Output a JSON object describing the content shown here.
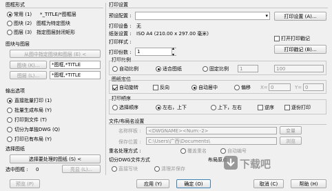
{
  "left": {
    "group_type": "图框形式",
    "radio_common": "常用 (1)",
    "common_value": "*_TITLE/*图框层",
    "radio_block": "图块 (2)",
    "block_desc": "图框为特定图块",
    "radio_layer": "图层 (3)",
    "layer_desc": "指定图层封闭矩形",
    "group_block_layer": "图块与图层",
    "pick_button": "从图中指定图块和图层 (E) <",
    "block_button": "图块 (K)...",
    "block_value": "*图框,*TITLE",
    "layer_button": "图层 (L)...",
    "layer_value": "*图框,*TITLE",
    "group_output": "输出选项",
    "opt1": "直接批量打印 (1)",
    "opt2": "批量生成布局 (Y)",
    "opt3": "打印到文件 (T)",
    "opt4": "切分为单独DWG (Q)",
    "opt5": "打印已有布局 (Y)",
    "group_select": "选择图纸",
    "select_button": "选择要处理的图纸 (S) <",
    "selected_label": "选中图框 :",
    "selected_count": "0",
    "highlight_button": "亮显 (L)..."
  },
  "right": {
    "group_print": "打印设置",
    "preset_label": "预设配置 :",
    "print_settings_button": "打印设置 (A)...",
    "device_label": "打印设备 :",
    "device_value": "无",
    "paper_label": "纸张设置 :",
    "paper_value": "ISO A4 (210.00 x 297.00 毫米)",
    "stamp_label": "打开打印戳记",
    "style_label": "打印样式 :",
    "stamp_button": "打印戳记 (B)...",
    "copies_label": "打印份数 :",
    "copies_value": "1",
    "group_scale": "打印比例",
    "scale_custom": "自动比例",
    "scale_fit": "适合图纸",
    "scale_fixed": "固定比例",
    "scale_ratio": "1",
    "scale_value": "100",
    "group_position": "图纸定位",
    "auto_rotate": "自动旋转",
    "reverse": "反向",
    "auto_center": "自动居中",
    "offset": "偏移",
    "x_label": "X=",
    "x_value": "0",
    "y_label": "Y=",
    "y_value": "0",
    "group_order": "打印顺序",
    "order_select": "选择顺序",
    "order_lr": "左右，上下",
    "order_ud": "上下，左右",
    "reverse_order": "逆序",
    "page_by_page": "逐份打印",
    "group_file": "文件/布局名设置",
    "name_label": "名称样板 :",
    "name_value": "<DWGNAME><Num:-2>",
    "variable_button": "变量",
    "save_label": "保存位置 :",
    "save_value": "C:\\Users\\广西\\Documents\\",
    "browse_button": "浏览",
    "rename_label": "重名处理方式 :",
    "rename_overwrite": "覆盖重名",
    "rename_auto": "自动编号",
    "layout_label": "布局原点",
    "group_split": "切分DWG文件方式",
    "split_copy": "直接写块",
    "split_clean": "清理并保存"
  },
  "bottom": {
    "preview_button": "预览 (P)",
    "apply_button": "应用 (Y)",
    "ok_button": "确定 (O)",
    "cancel_button": "取消 (C)",
    "help_button": "帮助 (H)"
  },
  "watermark": "下载吧"
}
